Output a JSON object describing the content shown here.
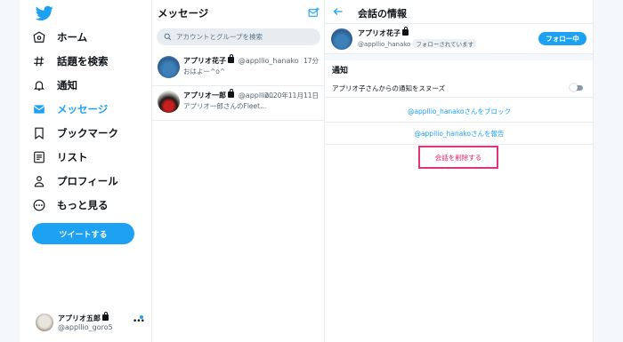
{
  "colors": {
    "accent": "#1da1f2",
    "danger": "#e0245e",
    "highlight": "#e0357a"
  },
  "nav": {
    "items": [
      {
        "icon": "home-icon",
        "label": "ホーム",
        "active": false
      },
      {
        "icon": "hashtag-icon",
        "label": "話題を検索",
        "active": false
      },
      {
        "icon": "bell-icon",
        "label": "通知",
        "active": false
      },
      {
        "icon": "envelope-icon",
        "label": "メッセージ",
        "active": true
      },
      {
        "icon": "bookmark-icon",
        "label": "ブックマーク",
        "active": false
      },
      {
        "icon": "list-icon",
        "label": "リスト",
        "active": false
      },
      {
        "icon": "person-icon",
        "label": "プロフィール",
        "active": false
      },
      {
        "icon": "more-circle-icon",
        "label": "もっと見る",
        "active": false
      }
    ],
    "tweet_label": "ツイートする",
    "account": {
      "name": "アプリオ五郎",
      "handle": "@appllio_goro5"
    }
  },
  "messages": {
    "title": "メッセージ",
    "search_placeholder": "アカウントとグループを検索",
    "conversations": [
      {
        "name": "アプリオ花子",
        "handle": "@appllio_hanako",
        "time": "17分",
        "preview": "おはよー^o^"
      },
      {
        "name": "アプリオ一郎",
        "handle": "@appllio...",
        "time": "2020年11月11日",
        "preview": "アプリオ一郎さんのFleet..."
      }
    ]
  },
  "info": {
    "title": "会話の情報",
    "user": {
      "name": "アプリオ花子",
      "handle": "@appllio_hanako",
      "follows_you": "フォローされています",
      "follow_label": "フォロー中"
    },
    "notifications_title": "通知",
    "snooze_label": "アプリオ子さんからの通知をスヌーズ",
    "block_label": "@appllio_hanakoさんをブロック",
    "report_label": "@appllio_hanakoさんを報告",
    "delete_label": "会話を削除する"
  }
}
